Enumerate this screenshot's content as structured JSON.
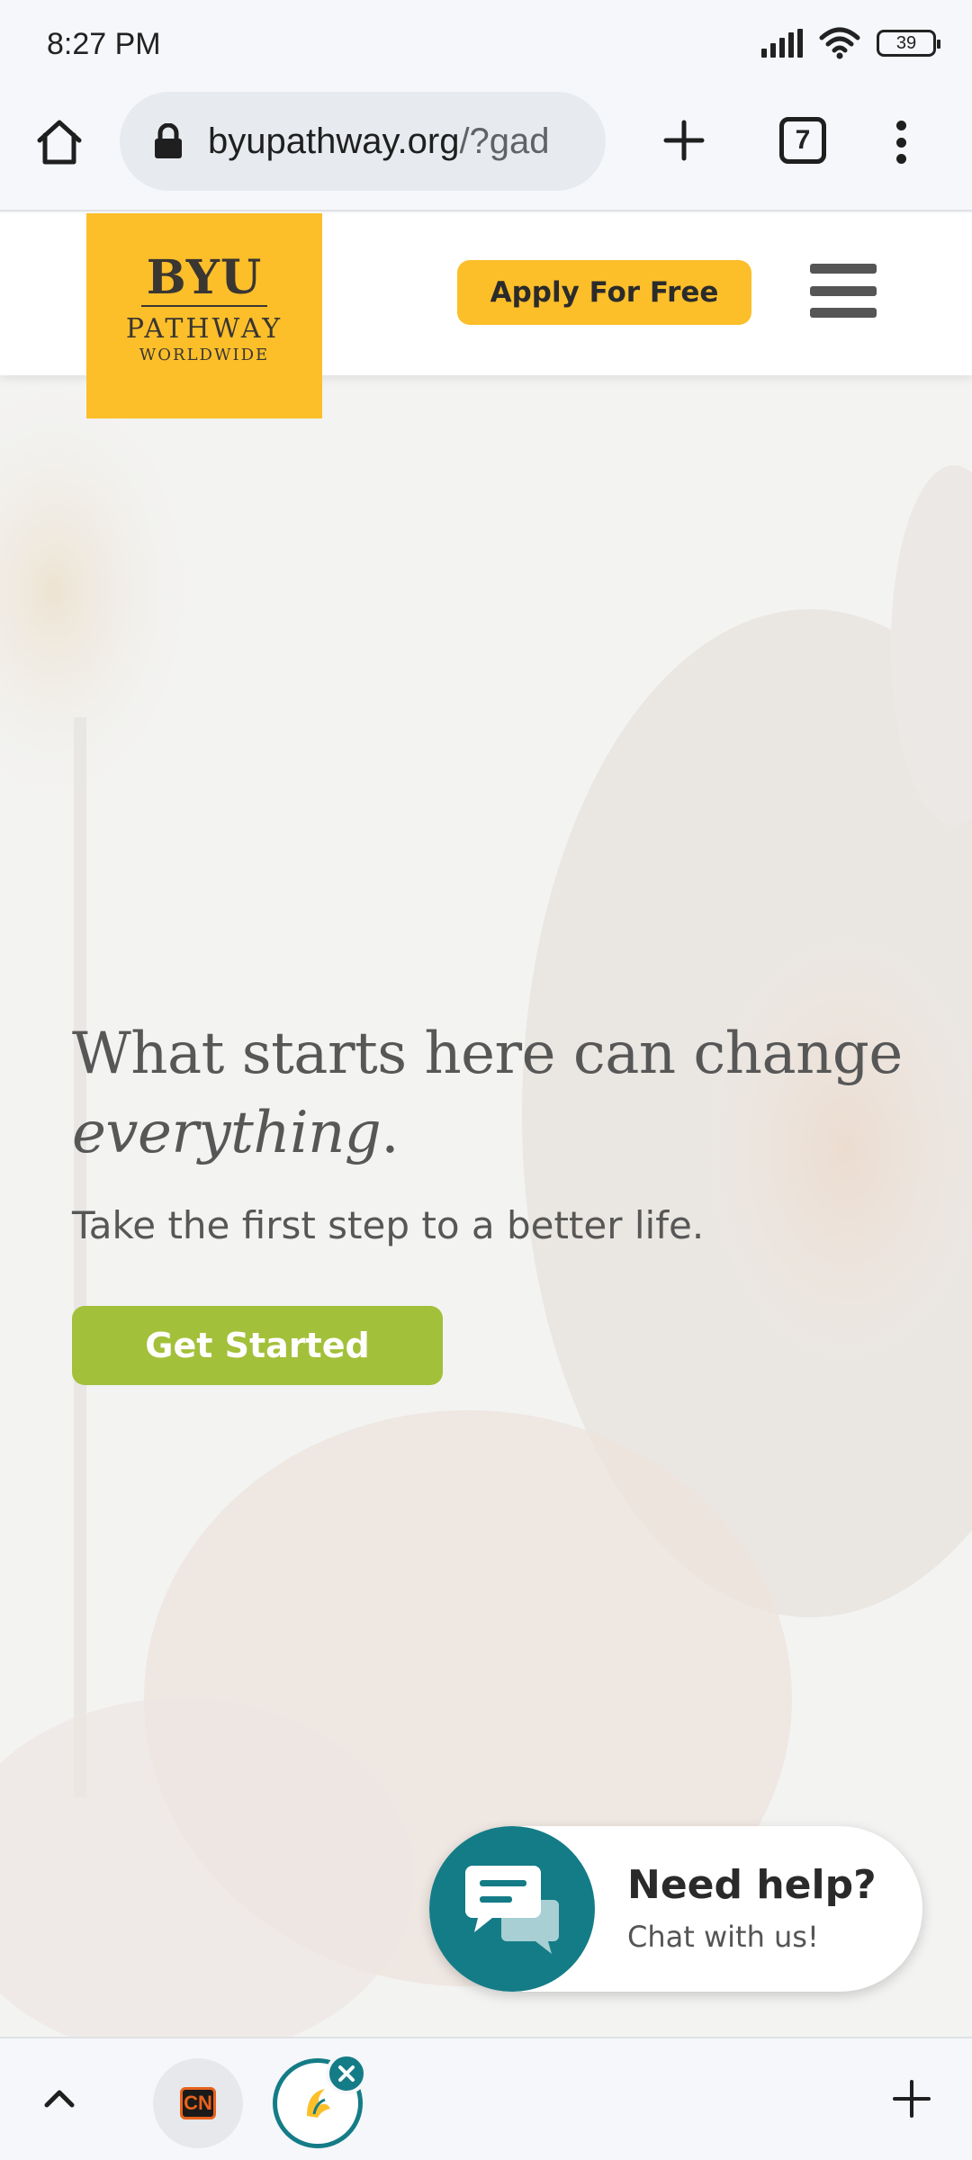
{
  "status_bar": {
    "time": "8:27 PM",
    "battery": "39"
  },
  "browser": {
    "url_domain": "byupathway.org",
    "url_path": "/?gad",
    "tab_count": "7",
    "icons": [
      "home-icon",
      "lock-icon",
      "plus-icon",
      "tabs-icon",
      "more-vert-icon"
    ]
  },
  "site_header": {
    "logo_main": "BYU",
    "logo_sub": "PATHWAY",
    "logo_sub2": "WORLDWIDE",
    "apply_label": "Apply For Free"
  },
  "hero": {
    "title_main": "What starts here can change",
    "title_em": "everything",
    "title_end": ".",
    "subtitle": "Take the first step to a better life.",
    "cta_label": "Get Started"
  },
  "chat": {
    "title": "Need help?",
    "subtitle": "Chat with us!"
  },
  "bottom_bar": {
    "tab1_label": "CN",
    "icons": [
      "chevron-up-icon",
      "close-icon",
      "plus-icon"
    ]
  },
  "colors": {
    "brand_yellow": "#fcbf2a",
    "cta_green": "#a3c03a",
    "chat_teal": "#147c86"
  }
}
